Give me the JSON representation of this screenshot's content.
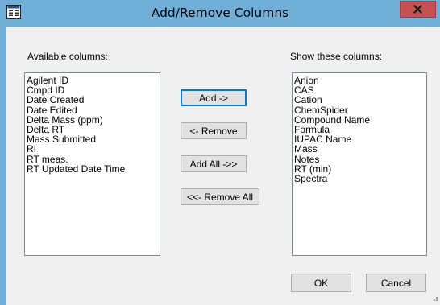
{
  "window": {
    "title": "Add/Remove Columns",
    "close_glyph": "X"
  },
  "available": {
    "label": "Available columns:",
    "items": [
      "Agilent ID",
      "Cmpd ID",
      "Date Created",
      "Date Edited",
      "Delta Mass (ppm)",
      "Delta RT",
      "Mass Submitted",
      "RI",
      "RT meas.",
      "RT Updated Date Time"
    ]
  },
  "shown": {
    "label": "Show these columns:",
    "items": [
      "Anion",
      "CAS",
      "Cation",
      "ChemSpider",
      "Compound Name",
      "Formula",
      "IUPAC Name",
      "Mass",
      "Notes",
      "RT (min)",
      "Spectra"
    ]
  },
  "actions": {
    "add": "Add ->",
    "remove": "<- Remove",
    "add_all": "Add All ->>",
    "remove_all": "<<- Remove All"
  },
  "footer": {
    "ok": "OK",
    "cancel": "Cancel"
  },
  "colors": {
    "titlebar": "#70b0d8",
    "close_button": "#c75050",
    "client_background": "#f0f0f0",
    "focus_border": "#0078d7"
  },
  "icons": {
    "title": "dialog-app-icon",
    "close": "close-icon",
    "grip": "resize-grip-icon"
  }
}
